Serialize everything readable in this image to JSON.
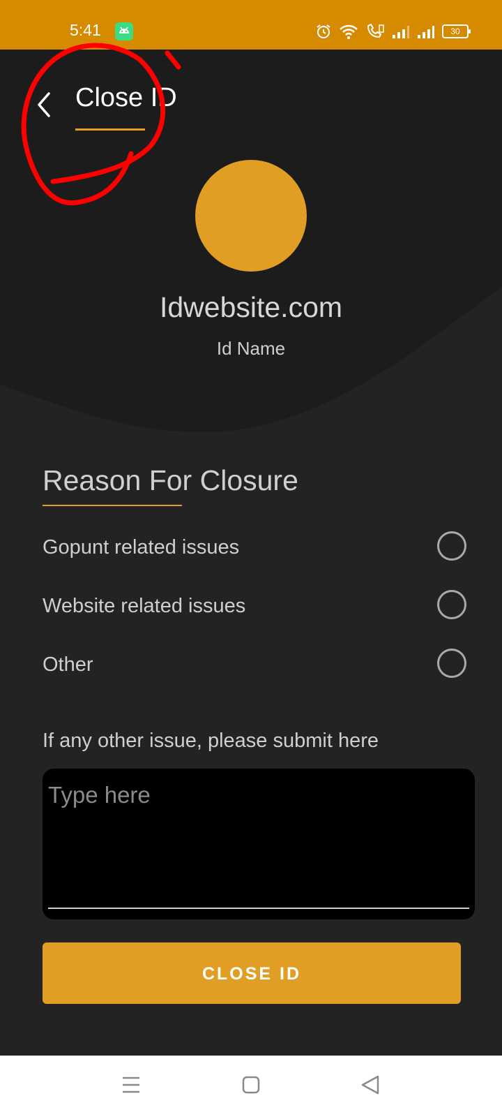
{
  "status_bar": {
    "time": "5:41",
    "battery": "30"
  },
  "header": {
    "title": "Close ID"
  },
  "profile": {
    "website": "Idwebsite.com",
    "id_name": "Id Name",
    "avatar_color": "#e19e25"
  },
  "reason_section": {
    "title": "Reason For Closure",
    "options": [
      {
        "label": "Gopunt related issues",
        "selected": false
      },
      {
        "label": "Website related issues",
        "selected": false
      },
      {
        "label": "Other",
        "selected": false
      }
    ]
  },
  "other_issue": {
    "label": "If any other issue, please submit here",
    "placeholder": "Type here",
    "value": ""
  },
  "submit_button": {
    "label": "CLOSE ID"
  },
  "colors": {
    "accent": "#e19e25",
    "status_bar": "#d68a00",
    "header_background": "#1c1c1c",
    "body_background": "#232323",
    "annotation": "#ff0000"
  },
  "nav": {
    "icons": [
      "menu-icon",
      "home-square-icon",
      "back-triangle-icon"
    ]
  }
}
